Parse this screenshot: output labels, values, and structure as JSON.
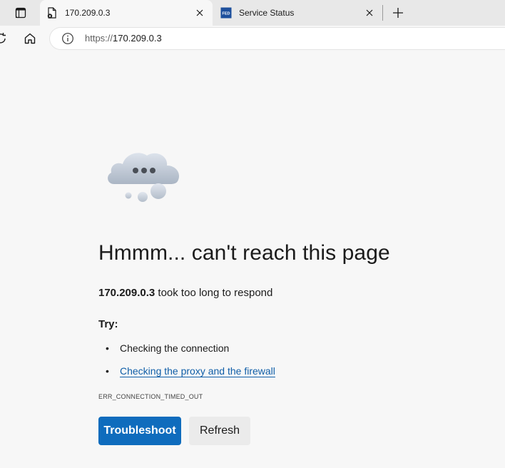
{
  "browser": {
    "tabs": [
      {
        "title": "170.209.0.3",
        "favicon": "error-page-icon",
        "active": true
      },
      {
        "title": "Service Status",
        "favicon": "fed-logo-icon",
        "active": false
      }
    ],
    "address": {
      "scheme": "https://",
      "host": "170.209.0.3"
    }
  },
  "page": {
    "title": "Hmmm... can't reach this page",
    "subtitle_host": "170.209.0.3",
    "subtitle_rest": " took too long to respond",
    "try_label": "Try:",
    "suggestions": [
      {
        "text": "Checking the connection",
        "link": false
      },
      {
        "text": "Checking the proxy and the firewall",
        "link": true
      }
    ],
    "error_code": "ERR_CONNECTION_TIMED_OUT",
    "buttons": {
      "troubleshoot": "Troubleshoot",
      "refresh": "Refresh"
    }
  },
  "colors": {
    "accent": "#0f6cbd",
    "link": "#0f5ea8",
    "page_bg": "#f7f7f7",
    "tabstrip_bg": "#e8e8e8"
  }
}
